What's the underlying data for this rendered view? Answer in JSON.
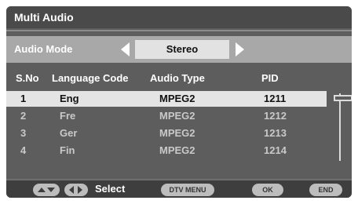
{
  "title": "Multi Audio",
  "audio_mode": {
    "label": "Audio Mode",
    "value": "Stereo"
  },
  "table": {
    "headers": [
      "S.No",
      "Language Code",
      "Audio Type",
      "PID"
    ],
    "rows": [
      {
        "sno": "1",
        "lang": "Eng",
        "type": "MPEG2",
        "pid": "1211",
        "selected": true
      },
      {
        "sno": "2",
        "lang": "Fre",
        "type": "MPEG2",
        "pid": "1212",
        "selected": false
      },
      {
        "sno": "3",
        "lang": "Ger",
        "type": "MPEG2",
        "pid": "1213",
        "selected": false
      },
      {
        "sno": "4",
        "lang": "Fin",
        "type": "MPEG2",
        "pid": "1214",
        "selected": false
      }
    ]
  },
  "footer": {
    "select_label": "Select",
    "dtv_menu": "DTV MENU",
    "ok": "OK",
    "end": "END"
  },
  "colors": {
    "panel_bg": "#5d5d5d",
    "highlight": "#e4e4e4"
  }
}
